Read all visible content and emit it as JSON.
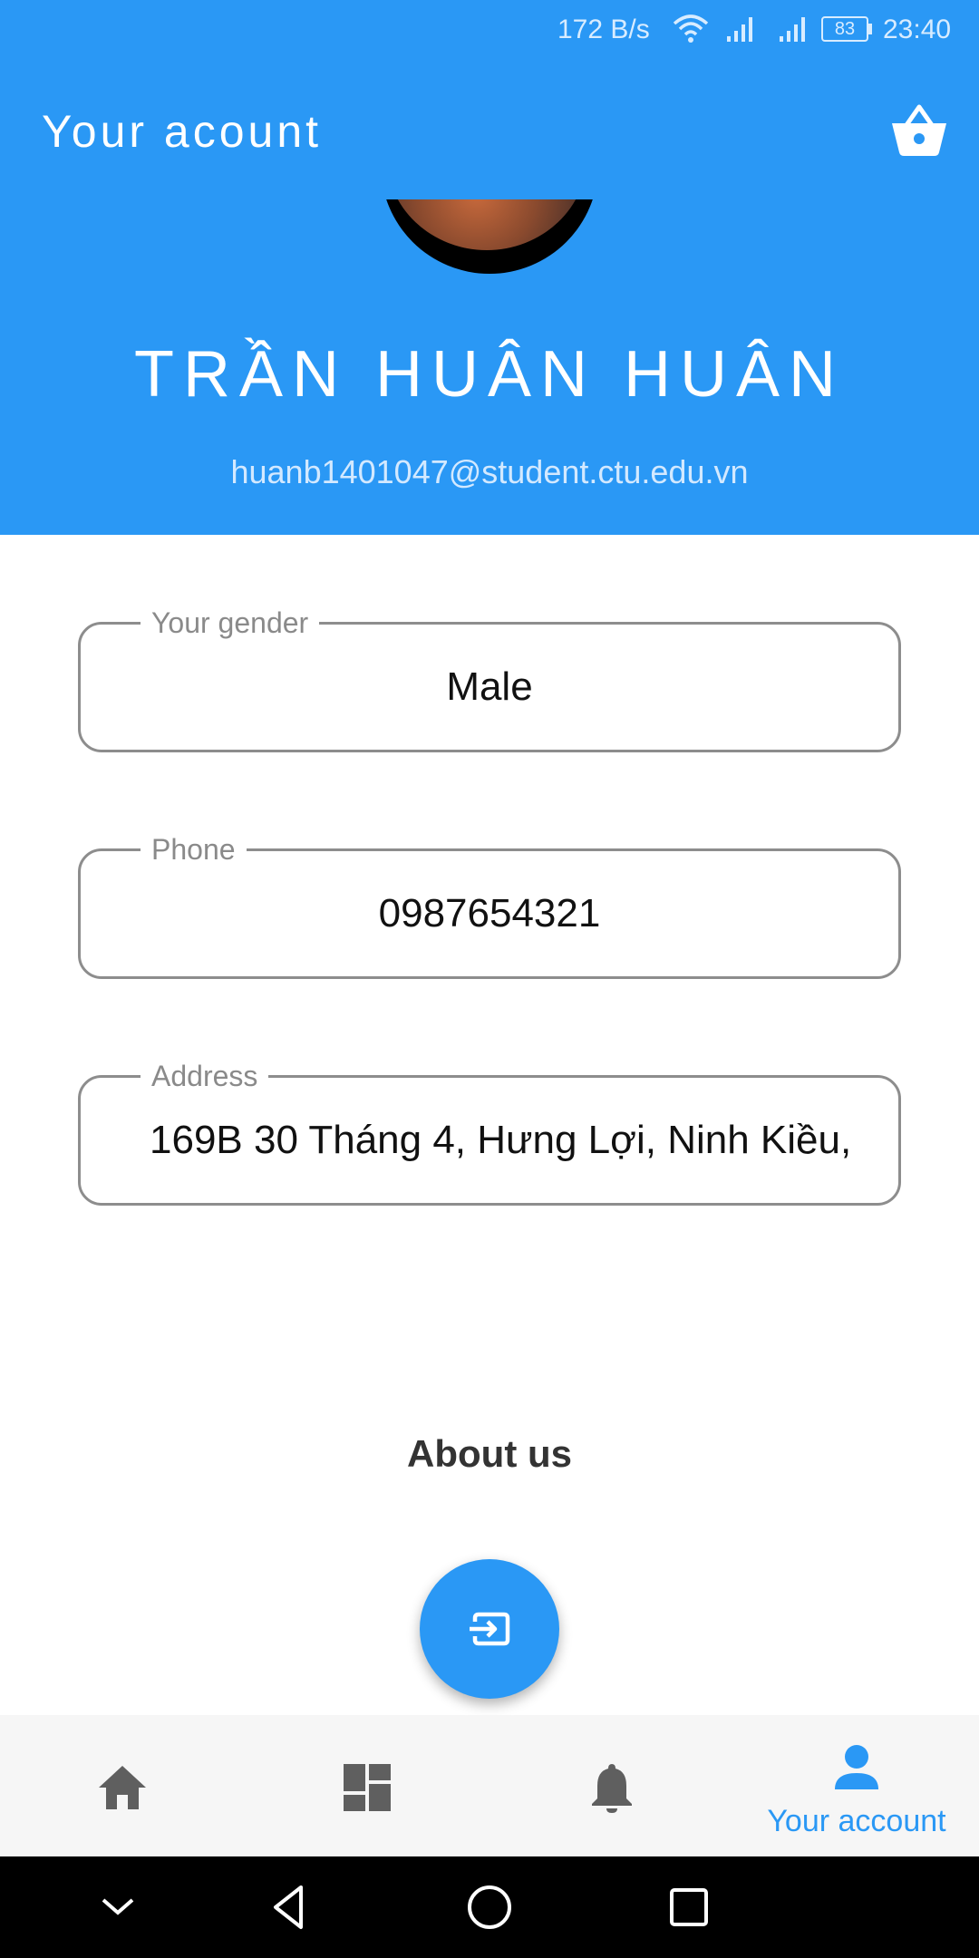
{
  "status_bar": {
    "net_speed": "172 B/s",
    "battery": "83",
    "time": "23:40"
  },
  "app_bar": {
    "title": "Your acount",
    "cart_icon": "shopping-basket-icon"
  },
  "profile": {
    "name": "TRẦN HUÂN HUÂN",
    "email": "huanb1401047@student.ctu.edu.vn"
  },
  "fields": {
    "gender": {
      "label": "Your gender",
      "value": "Male"
    },
    "phone": {
      "label": "Phone",
      "value": "0987654321"
    },
    "address": {
      "label": "Address",
      "value": "169B 30 Tháng 4, Hưng Lợi, Ninh Kiều,"
    }
  },
  "about": {
    "label": "About us"
  },
  "fab": {
    "icon": "logout-icon"
  },
  "bottom_nav": {
    "items": [
      {
        "icon": "home-icon",
        "label": ""
      },
      {
        "icon": "dashboard-icon",
        "label": ""
      },
      {
        "icon": "bell-icon",
        "label": ""
      },
      {
        "icon": "person-icon",
        "label": "Your account",
        "active": true
      }
    ]
  },
  "colors": {
    "primary": "#2a98f5",
    "inactive_icon": "#5f5f5f",
    "nav_background": "#f6f6f6"
  }
}
